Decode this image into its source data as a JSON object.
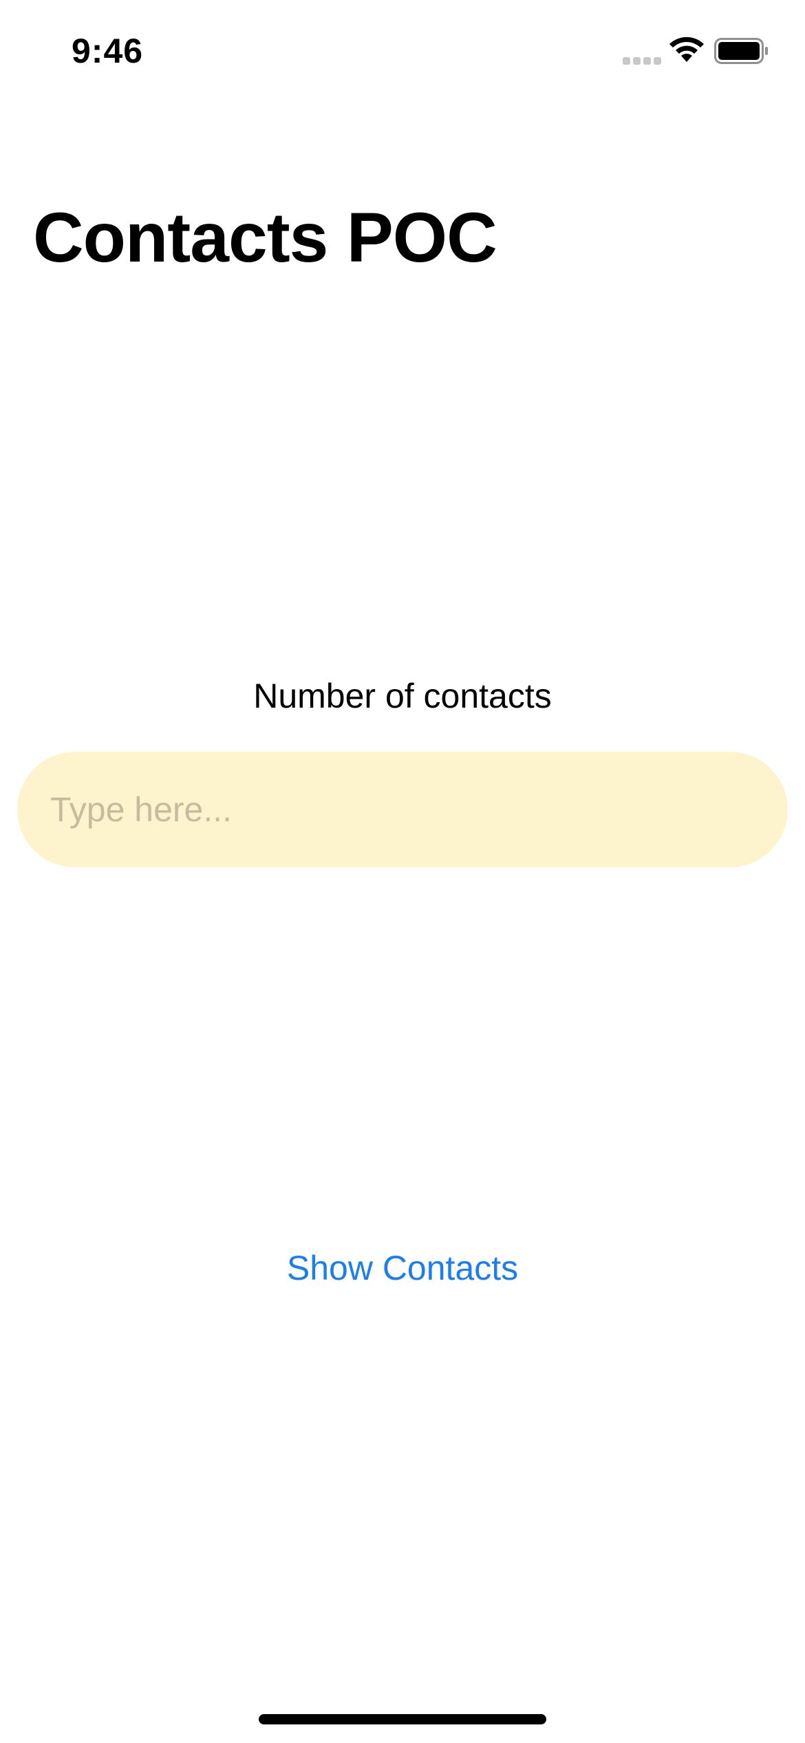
{
  "status_bar": {
    "time": "9:46",
    "icons": [
      "cellular-signal-icon",
      "wifi-icon",
      "battery-icon"
    ]
  },
  "header": {
    "title": "Contacts POC"
  },
  "form": {
    "label": "Number of contacts",
    "input_value": "",
    "input_placeholder": "Type here...",
    "input_background": "#fdf4ce"
  },
  "actions": {
    "show_contacts_label": "Show Contacts",
    "accent_color": "#1a7ef0"
  }
}
